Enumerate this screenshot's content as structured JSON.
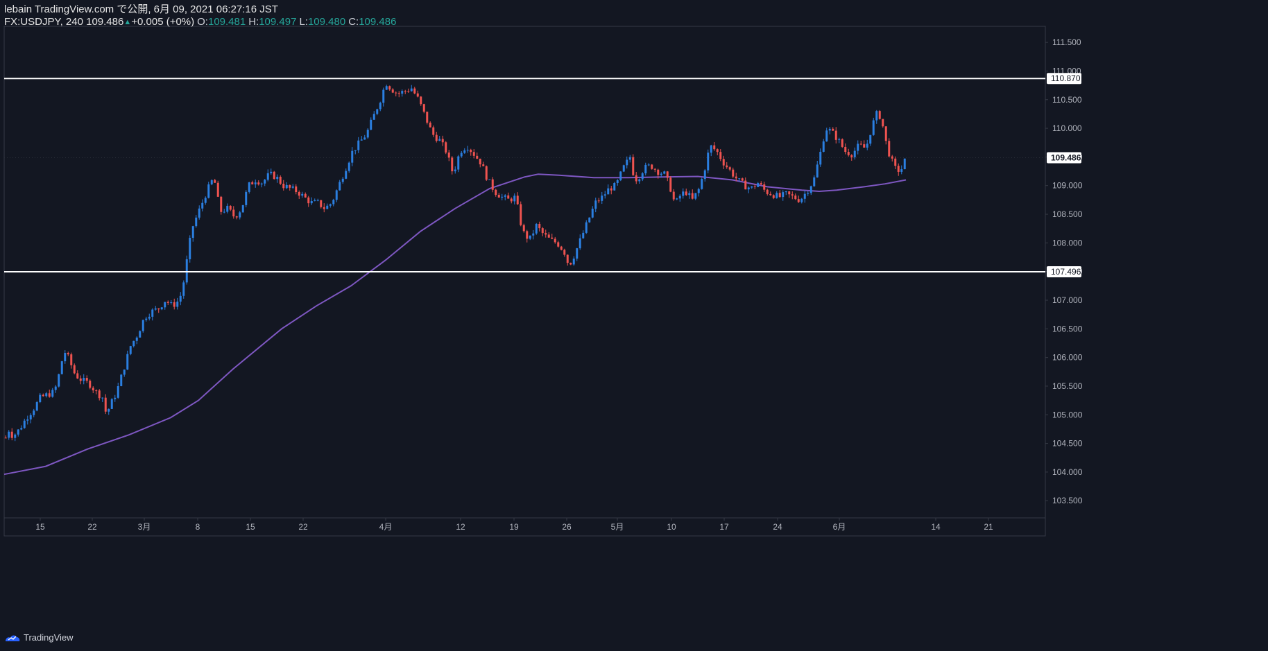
{
  "header": {
    "line1": "lebain TradingView.com で公開, 6月 09, 2021 06:27:16 JST",
    "symbol_line": "FX:USDJPY, 240 109.486",
    "change": "+0.005 (+0%)",
    "o_label": "O:",
    "o_value": "109.481",
    "h_label": "H:",
    "h_value": "109.497",
    "l_label": "L:",
    "l_value": "109.480",
    "c_label": "C:",
    "c_value": "109.486"
  },
  "footer": {
    "brand": "TradingView"
  },
  "colors": {
    "background": "#131722",
    "up": "#2b7fe0",
    "down": "#ef5350",
    "ma": "#7e57c2",
    "hline": "#ffffff",
    "axis_text": "#b2b5be"
  },
  "chart_data": {
    "type": "candlestick",
    "symbol": "FX:USDJPY",
    "timeframe": "240",
    "last_price": 109.486,
    "ylim": [
      103.2,
      111.8
    ],
    "y_ticks": [
      "111.500",
      "111.000",
      "110.500",
      "110.000",
      "109.500",
      "109.000",
      "108.500",
      "108.000",
      "107.500",
      "107.000",
      "106.500",
      "106.000",
      "105.500",
      "105.000",
      "104.500",
      "104.000",
      "103.500"
    ],
    "x_ticks": [
      "15",
      "22",
      "3月",
      "8",
      "15",
      "22",
      "4月",
      "12",
      "19",
      "26",
      "5月",
      "10",
      "17",
      "24",
      "6月",
      "14",
      "21"
    ],
    "horizontal_lines": [
      110.87,
      107.496
    ],
    "price_labels": [
      "110.870",
      "107.496",
      "109.486"
    ],
    "price_path": [
      [
        0,
        104.6
      ],
      [
        5,
        104.75
      ],
      [
        10,
        104.62
      ],
      [
        20,
        104.75
      ],
      [
        30,
        104.95
      ],
      [
        40,
        105.1
      ],
      [
        50,
        105.3
      ],
      [
        60,
        105.35
      ],
      [
        70,
        105.4
      ],
      [
        75,
        105.6
      ],
      [
        80,
        105.9
      ],
      [
        85,
        106.1
      ],
      [
        90,
        106.0
      ],
      [
        95,
        105.85
      ],
      [
        100,
        105.7
      ],
      [
        110,
        105.6
      ],
      [
        120,
        105.55
      ],
      [
        130,
        105.4
      ],
      [
        140,
        105.3
      ],
      [
        145,
        105.0
      ],
      [
        150,
        105.15
      ],
      [
        160,
        105.4
      ],
      [
        170,
        105.8
      ],
      [
        180,
        106.2
      ],
      [
        190,
        106.4
      ],
      [
        200,
        106.7
      ],
      [
        210,
        106.8
      ],
      [
        220,
        106.85
      ],
      [
        230,
        107.0
      ],
      [
        240,
        106.9
      ],
      [
        250,
        107.0
      ],
      [
        255,
        107.2
      ],
      [
        260,
        107.6
      ],
      [
        265,
        108.0
      ],
      [
        270,
        108.3
      ],
      [
        280,
        108.6
      ],
      [
        290,
        108.9
      ],
      [
        300,
        109.15
      ],
      [
        305,
        108.8
      ],
      [
        310,
        108.55
      ],
      [
        320,
        108.6
      ],
      [
        330,
        108.45
      ],
      [
        340,
        108.6
      ],
      [
        350,
        109.0
      ],
      [
        360,
        109.1
      ],
      [
        370,
        109.05
      ],
      [
        380,
        109.2
      ],
      [
        390,
        109.15
      ],
      [
        400,
        109.0
      ],
      [
        410,
        108.95
      ],
      [
        420,
        108.9
      ],
      [
        430,
        108.8
      ],
      [
        440,
        108.7
      ],
      [
        450,
        108.7
      ],
      [
        460,
        108.6
      ],
      [
        470,
        108.7
      ],
      [
        480,
        109.0
      ],
      [
        490,
        109.3
      ],
      [
        500,
        109.6
      ],
      [
        510,
        109.75
      ],
      [
        520,
        109.9
      ],
      [
        530,
        110.2
      ],
      [
        540,
        110.5
      ],
      [
        548,
        110.8
      ],
      [
        555,
        110.7
      ],
      [
        565,
        110.6
      ],
      [
        575,
        110.65
      ],
      [
        585,
        110.7
      ],
      [
        595,
        110.5
      ],
      [
        605,
        110.2
      ],
      [
        615,
        109.9
      ],
      [
        625,
        109.8
      ],
      [
        635,
        109.6
      ],
      [
        645,
        109.2
      ],
      [
        655,
        109.6
      ],
      [
        665,
        109.7
      ],
      [
        675,
        109.55
      ],
      [
        685,
        109.4
      ],
      [
        695,
        109.1
      ],
      [
        705,
        108.9
      ],
      [
        715,
        108.8
      ],
      [
        725,
        108.75
      ],
      [
        735,
        108.8
      ],
      [
        745,
        108.2
      ],
      [
        755,
        108.05
      ],
      [
        765,
        108.3
      ],
      [
        775,
        108.15
      ],
      [
        785,
        108.05
      ],
      [
        795,
        108.0
      ],
      [
        805,
        107.85
      ],
      [
        812,
        107.6
      ],
      [
        820,
        107.8
      ],
      [
        830,
        108.1
      ],
      [
        840,
        108.4
      ],
      [
        850,
        108.7
      ],
      [
        860,
        108.8
      ],
      [
        870,
        108.95
      ],
      [
        880,
        109.0
      ],
      [
        890,
        109.3
      ],
      [
        900,
        109.5
      ],
      [
        905,
        109.2
      ],
      [
        910,
        109.1
      ],
      [
        920,
        109.3
      ],
      [
        930,
        109.35
      ],
      [
        940,
        109.25
      ],
      [
        950,
        109.2
      ],
      [
        960,
        108.9
      ],
      [
        965,
        108.65
      ],
      [
        970,
        108.8
      ],
      [
        980,
        108.9
      ],
      [
        990,
        108.75
      ],
      [
        1000,
        108.95
      ],
      [
        1010,
        109.4
      ],
      [
        1015,
        109.7
      ],
      [
        1025,
        109.6
      ],
      [
        1035,
        109.4
      ],
      [
        1045,
        109.25
      ],
      [
        1055,
        109.1
      ],
      [
        1065,
        109.0
      ],
      [
        1075,
        108.95
      ],
      [
        1085,
        109.05
      ],
      [
        1095,
        108.9
      ],
      [
        1105,
        108.85
      ],
      [
        1115,
        108.8
      ],
      [
        1125,
        108.85
      ],
      [
        1135,
        108.8
      ],
      [
        1145,
        108.75
      ],
      [
        1155,
        108.9
      ],
      [
        1165,
        109.1
      ],
      [
        1175,
        109.6
      ],
      [
        1182,
        110.0
      ],
      [
        1190,
        109.95
      ],
      [
        1200,
        109.8
      ],
      [
        1210,
        109.6
      ],
      [
        1220,
        109.55
      ],
      [
        1230,
        109.7
      ],
      [
        1240,
        109.65
      ],
      [
        1248,
        110.0
      ],
      [
        1255,
        110.25
      ],
      [
        1262,
        110.2
      ],
      [
        1268,
        109.8
      ],
      [
        1275,
        109.5
      ],
      [
        1282,
        109.3
      ],
      [
        1290,
        109.25
      ],
      [
        1298,
        109.49
      ]
    ],
    "moving_average": [
      [
        0,
        103.96
      ],
      [
        60,
        104.1
      ],
      [
        120,
        104.4
      ],
      [
        180,
        104.65
      ],
      [
        240,
        104.95
      ],
      [
        280,
        105.25
      ],
      [
        330,
        105.8
      ],
      [
        400,
        106.5
      ],
      [
        450,
        106.9
      ],
      [
        500,
        107.25
      ],
      [
        550,
        107.7
      ],
      [
        600,
        108.2
      ],
      [
        650,
        108.6
      ],
      [
        700,
        108.95
      ],
      [
        750,
        109.15
      ],
      [
        770,
        109.2
      ],
      [
        800,
        109.18
      ],
      [
        850,
        109.14
      ],
      [
        900,
        109.14
      ],
      [
        950,
        109.15
      ],
      [
        1000,
        109.16
      ],
      [
        1050,
        109.1
      ],
      [
        1100,
        108.98
      ],
      [
        1150,
        108.92
      ],
      [
        1175,
        108.9
      ],
      [
        1200,
        108.92
      ],
      [
        1240,
        108.98
      ],
      [
        1270,
        109.03
      ],
      [
        1300,
        109.1
      ]
    ]
  }
}
